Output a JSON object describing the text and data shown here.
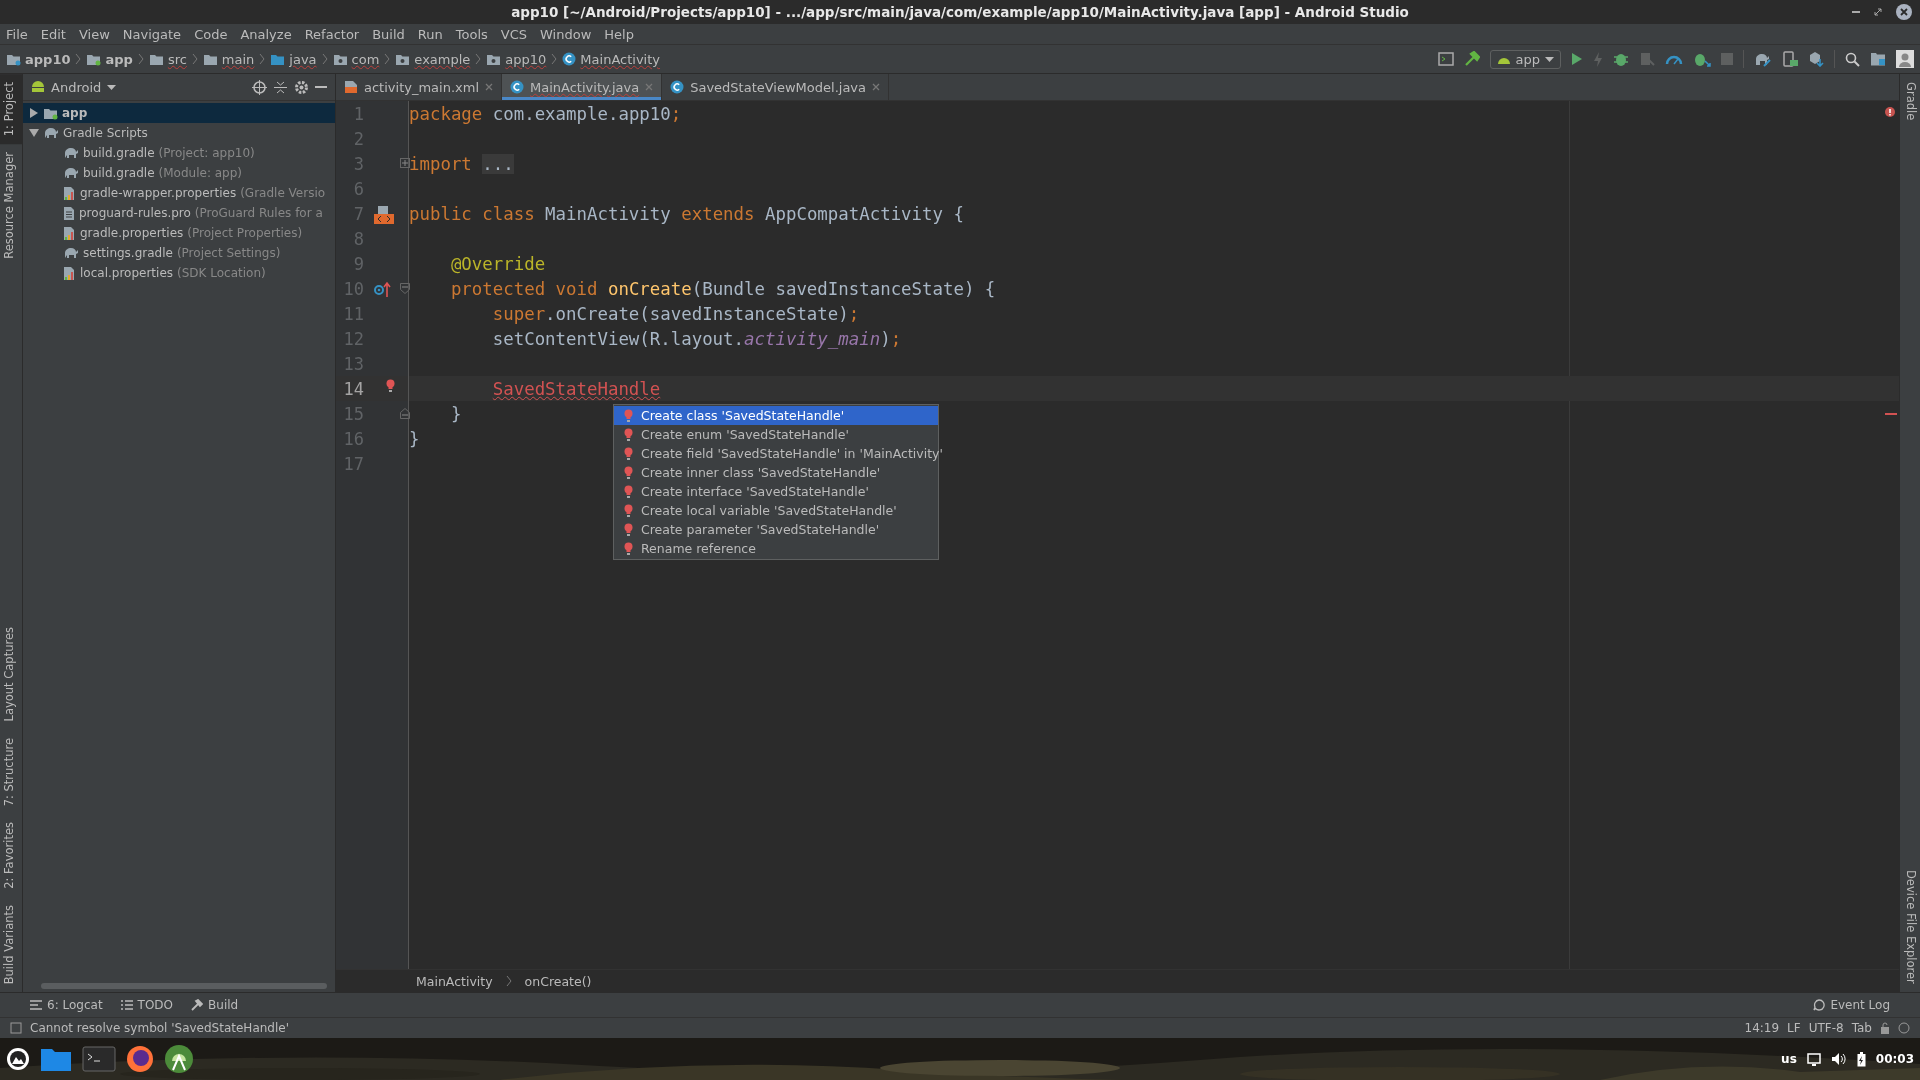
{
  "window": {
    "title": "app10 [~/Android/Projects/app10] - .../app/src/main/java/com/example/app10/MainActivity.java [app] - Android Studio"
  },
  "menu": [
    "File",
    "Edit",
    "View",
    "Navigate",
    "Code",
    "Analyze",
    "Refactor",
    "Build",
    "Run",
    "Tools",
    "VCS",
    "Window",
    "Help"
  ],
  "breadcrumbs": [
    {
      "label": "app10",
      "kind": "project"
    },
    {
      "label": "app",
      "kind": "module"
    },
    {
      "label": "src",
      "kind": "folder"
    },
    {
      "label": "main",
      "kind": "folder"
    },
    {
      "label": "java",
      "kind": "source"
    },
    {
      "label": "com",
      "kind": "package"
    },
    {
      "label": "example",
      "kind": "package"
    },
    {
      "label": "app10",
      "kind": "package"
    },
    {
      "label": "MainActivity",
      "kind": "class"
    }
  ],
  "run_config": {
    "label": "app"
  },
  "left_strip": [
    {
      "label": "1: Project",
      "selected": true
    },
    {
      "label": "Resource Manager",
      "selected": false
    },
    {
      "label": "Layout Captures",
      "selected": false
    },
    {
      "label": "7: Structure",
      "selected": false
    },
    {
      "label": "2: Favorites",
      "selected": false
    },
    {
      "label": "Build Variants",
      "selected": false
    }
  ],
  "right_strip": [
    {
      "label": "Gradle"
    },
    {
      "label": "Device File Explorer"
    }
  ],
  "project_panel": {
    "view": "Android",
    "tree": [
      {
        "name": "app",
        "kind": "module",
        "expanded": false,
        "selected": true
      },
      {
        "name": "Gradle Scripts",
        "kind": "gradle",
        "expanded": true,
        "selected": false,
        "children": [
          {
            "name": "build.gradle",
            "hint": "(Project: app10)",
            "kind": "gradle",
            "selected": false
          },
          {
            "name": "build.gradle",
            "hint": "(Module: app)",
            "kind": "gradle",
            "selected": false
          },
          {
            "name": "gradle-wrapper.properties",
            "hint": "(Gradle Versio",
            "kind": "properties",
            "selected": false
          },
          {
            "name": "proguard-rules.pro",
            "hint": "(ProGuard Rules for a",
            "kind": "text",
            "selected": false
          },
          {
            "name": "gradle.properties",
            "hint": "(Project Properties)",
            "kind": "properties",
            "selected": false
          },
          {
            "name": "settings.gradle",
            "hint": "(Project Settings)",
            "kind": "gradle",
            "selected": false
          },
          {
            "name": "local.properties",
            "hint": "(SDK Location)",
            "kind": "properties",
            "selected": false
          }
        ]
      }
    ]
  },
  "editor_tabs": [
    {
      "label": "activity_main.xml",
      "kind": "xml",
      "selected": false
    },
    {
      "label": "MainActivity.java",
      "kind": "class",
      "selected": true
    },
    {
      "label": "SavedStateViewModel.java",
      "kind": "class",
      "selected": false
    }
  ],
  "code": [
    {
      "number": "1",
      "current": false,
      "tokens": [
        {
          "kind": "keyword",
          "text": "package"
        },
        {
          "kind": "plain",
          "text": " com.example.app10"
        },
        {
          "kind": "keyword",
          "text": ";"
        }
      ]
    },
    {
      "number": "2",
      "current": false
    },
    {
      "number": "3",
      "current": false,
      "fold": {
        "kind": "expand"
      },
      "tokens": [
        {
          "kind": "keyword",
          "text": "import"
        },
        {
          "kind": "folded",
          "text": "..."
        }
      ]
    },
    {
      "number": "6",
      "current": false
    },
    {
      "number": "7",
      "current": false,
      "gutter": {
        "kind": "layout"
      },
      "tokens": [
        {
          "kind": "keyword",
          "text": "public class"
        },
        {
          "kind": "plain",
          "text": " MainActivity "
        },
        {
          "kind": "keyword",
          "text": "extends"
        },
        {
          "kind": "plain",
          "text": " AppCompatActivity {"
        }
      ]
    },
    {
      "number": "8",
      "current": false
    },
    {
      "number": "9",
      "current": false,
      "indent": {
        "kind": "member"
      },
      "tokens": [
        {
          "kind": "annotation",
          "text": "@Override"
        }
      ]
    },
    {
      "number": "10",
      "current": false,
      "indent": {
        "kind": "member"
      },
      "gutter": {
        "kind": "override"
      },
      "fold": {
        "kind": "start"
      },
      "tokens": [
        {
          "kind": "keyword",
          "text": "protected void"
        },
        {
          "kind": "method",
          "text": " onCreate"
        },
        {
          "kind": "plain",
          "text": "(Bundle savedInstanceState) {"
        }
      ]
    },
    {
      "number": "11",
      "current": false,
      "indent": {
        "kind": "body"
      },
      "tokens": [
        {
          "kind": "keyword",
          "text": "super"
        },
        {
          "kind": "plain",
          "text": ".onCreate(savedInstanceState)"
        },
        {
          "kind": "keyword",
          "text": ";"
        }
      ]
    },
    {
      "number": "12",
      "current": false,
      "indent": {
        "kind": "body"
      },
      "tokens": [
        {
          "kind": "plain",
          "text": "setContentView(R.layout."
        },
        {
          "kind": "field",
          "text": "activity_main"
        },
        {
          "kind": "plain",
          "text": ")"
        },
        {
          "kind": "keyword",
          "text": ";"
        }
      ]
    },
    {
      "number": "13",
      "current": false
    },
    {
      "number": "14",
      "current": true,
      "indent": {
        "kind": "body"
      },
      "gutter": {
        "kind": "bulb"
      },
      "tokens": [
        {
          "kind": "error",
          "text": "SavedStateHandle"
        }
      ]
    },
    {
      "number": "15",
      "current": false,
      "indent": {
        "kind": "member"
      },
      "fold": {
        "kind": "end"
      },
      "tokens": [
        {
          "kind": "plain",
          "text": "}"
        }
      ]
    },
    {
      "number": "16",
      "current": false,
      "tokens": [
        {
          "kind": "plain",
          "text": "}"
        }
      ]
    },
    {
      "number": "17",
      "current": false
    }
  ],
  "intention_popup": {
    "items": [
      {
        "label": "Create class 'SavedStateHandle'",
        "selected": true
      },
      {
        "label": "Create enum 'SavedStateHandle'",
        "selected": false
      },
      {
        "label": "Create field 'SavedStateHandle' in 'MainActivity'",
        "selected": false
      },
      {
        "label": "Create inner class 'SavedStateHandle'",
        "selected": false
      },
      {
        "label": "Create interface 'SavedStateHandle'",
        "selected": false
      },
      {
        "label": "Create local variable 'SavedStateHandle'",
        "selected": false
      },
      {
        "label": "Create parameter 'SavedStateHandle'",
        "selected": false
      },
      {
        "label": "Rename reference",
        "selected": false
      }
    ]
  },
  "editor_breadcrumbs": [
    "MainActivity",
    "onCreate()"
  ],
  "tool_tabs": [
    {
      "label": "6: Logcat",
      "kind": "logcat"
    },
    {
      "label": "TODO",
      "kind": "todo"
    },
    {
      "label": "Build",
      "kind": "build"
    }
  ],
  "event_log": "Event Log",
  "status_bar": {
    "message": "Cannot resolve symbol 'SavedStateHandle'",
    "items": [
      "14:19",
      "LF",
      "UTF-8",
      "Tab"
    ]
  },
  "taskbar": {
    "layout": "us",
    "time": "00:03"
  }
}
